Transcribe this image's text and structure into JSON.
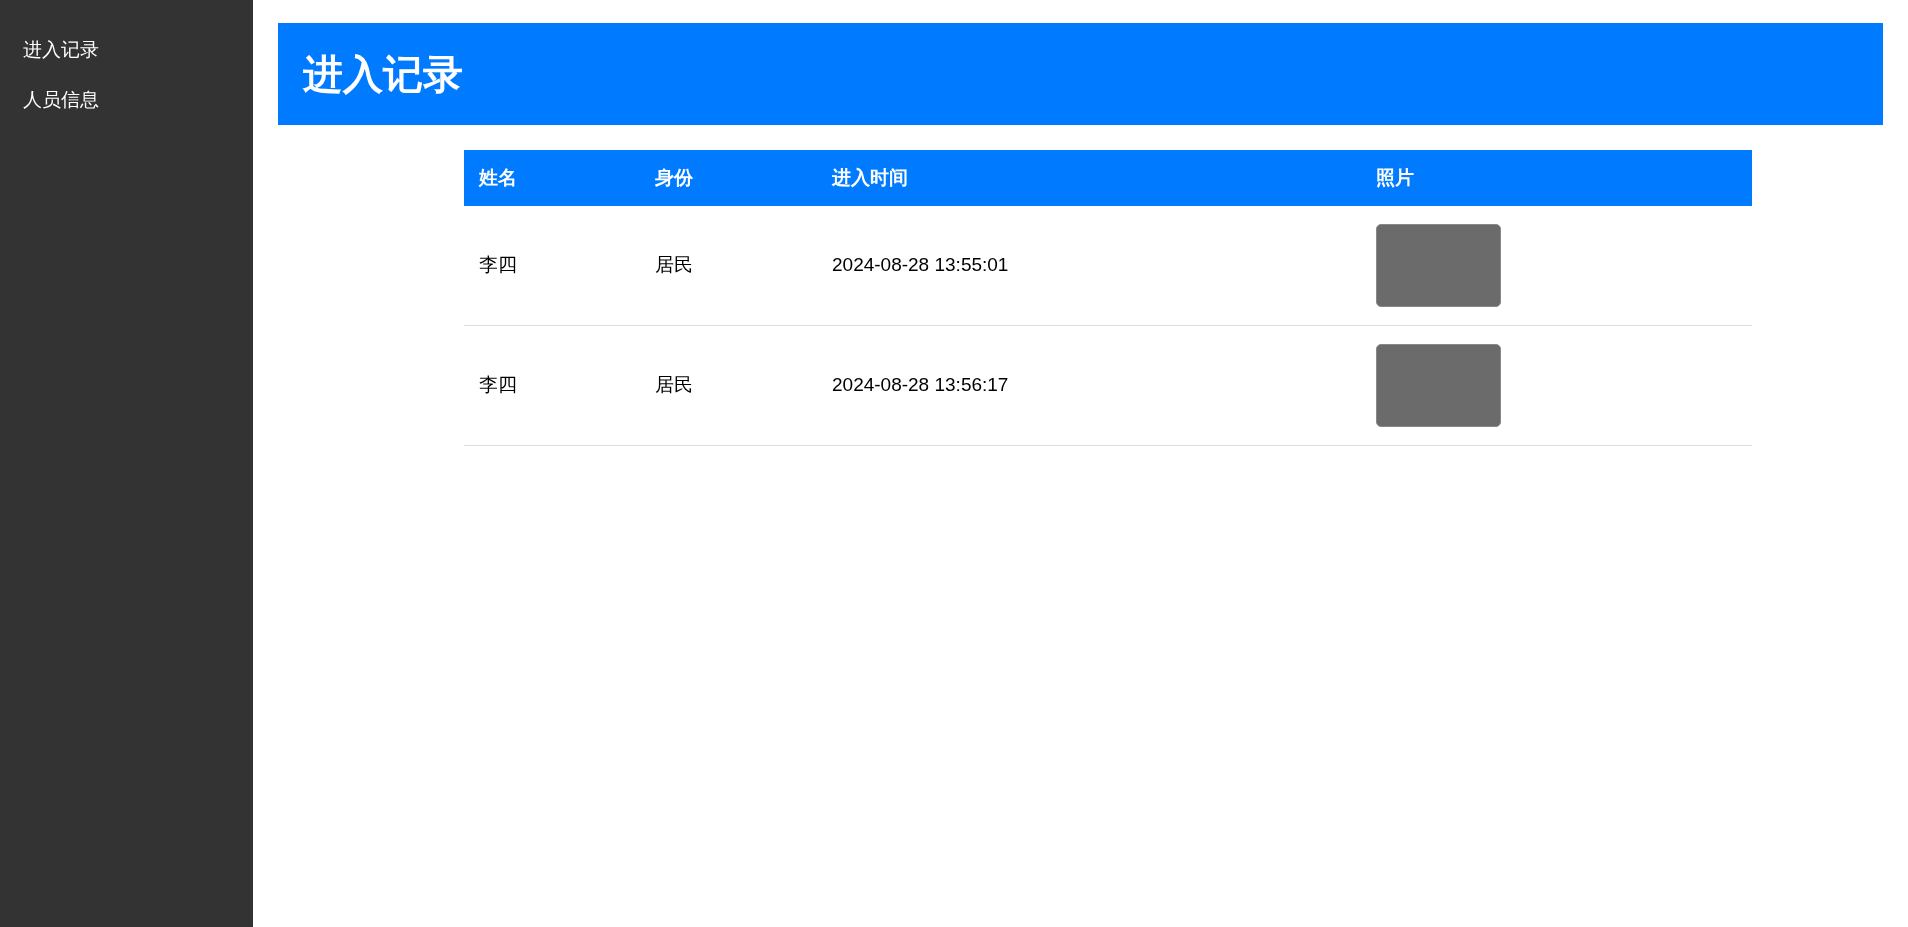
{
  "sidebar": {
    "items": [
      {
        "label": "进入记录"
      },
      {
        "label": "人员信息"
      }
    ]
  },
  "header": {
    "title": "进入记录"
  },
  "table": {
    "columns": [
      "姓名",
      "身份",
      "进入时间",
      "照片"
    ],
    "rows": [
      {
        "name": "李四",
        "role": "居民",
        "time": "2024-08-28 13:55:01"
      },
      {
        "name": "李四",
        "role": "居民",
        "time": "2024-08-28 13:56:17"
      }
    ]
  }
}
